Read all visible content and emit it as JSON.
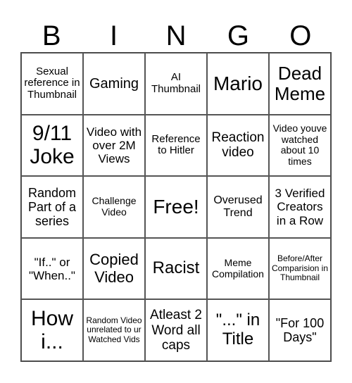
{
  "header": {
    "letters": [
      "B",
      "I",
      "N",
      "G",
      "O"
    ]
  },
  "grid": {
    "rows": [
      [
        "Sexual reference in Thumbnail",
        "Gaming",
        "AI Thumbnail",
        "Mario",
        "Dead Meme"
      ],
      [
        "9/11 Joke",
        "Video with over 2M Views",
        "Reference to Hitler",
        "Reaction video",
        "Video youve watched about 10 times"
      ],
      [
        "Random Part of a series",
        "Challenge Video",
        "Free!",
        "Overused Trend",
        "3 Verified Creators in a Row"
      ],
      [
        "\"If..\" or \"When..\"",
        "Copied Video",
        "Racist",
        "Meme Compilation",
        "Before/After Comparision in Thumbnail"
      ],
      [
        "How i...",
        "Random Video unrelated to ur Watched Vids",
        "Atleast 2 Word all caps",
        "\"...\" in Title",
        "\"For 100 Days\""
      ]
    ]
  }
}
